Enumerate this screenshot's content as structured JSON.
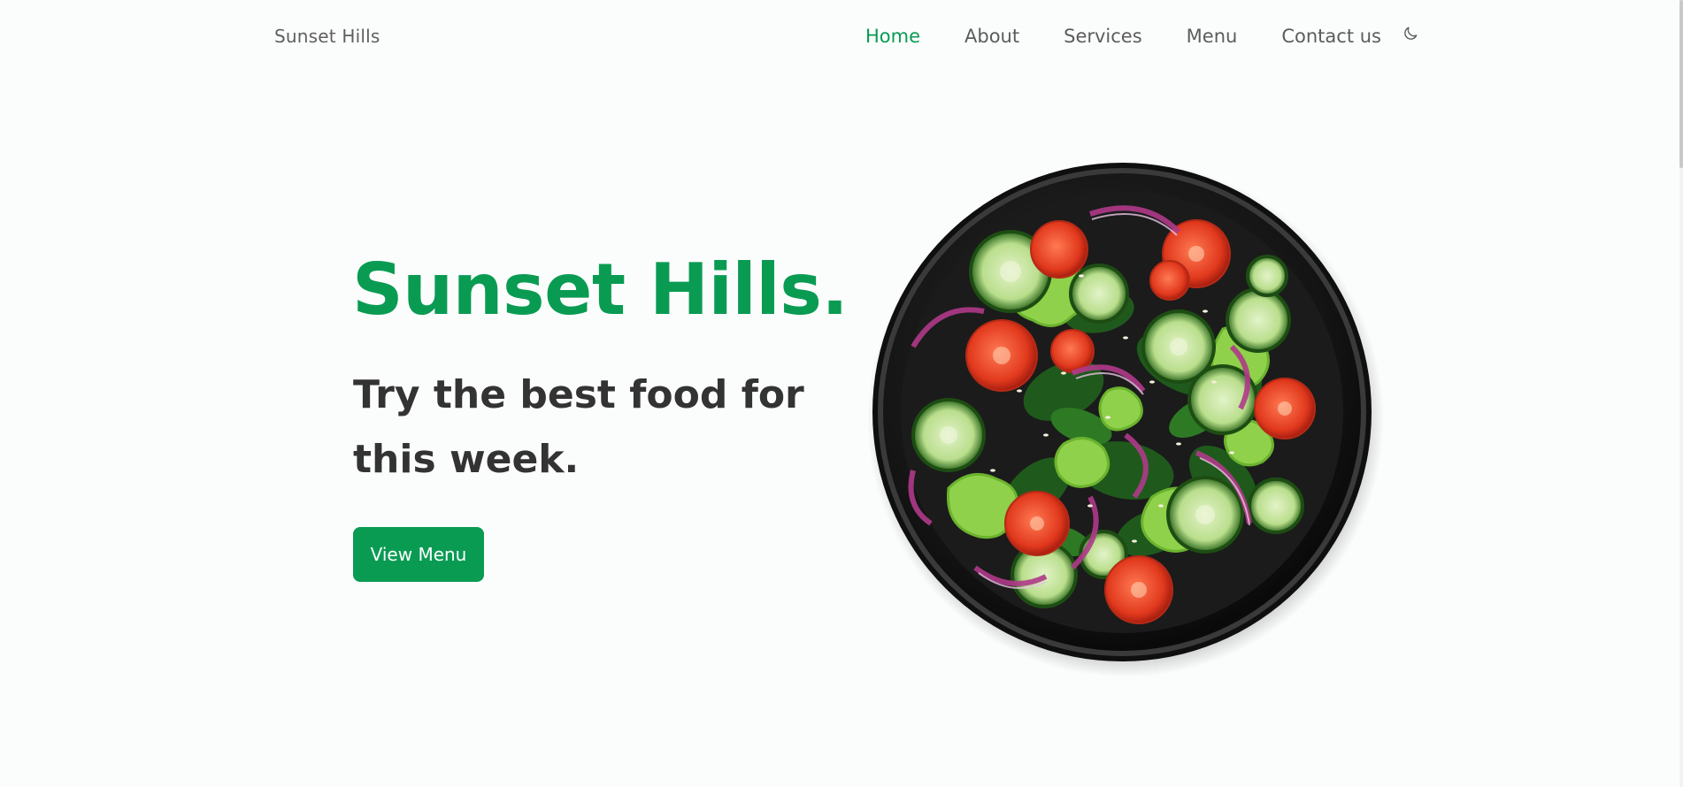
{
  "header": {
    "brand": "Sunset Hills",
    "nav": [
      {
        "label": "Home",
        "active": true
      },
      {
        "label": "About",
        "active": false
      },
      {
        "label": "Services",
        "active": false
      },
      {
        "label": "Menu",
        "active": false
      },
      {
        "label": "Contact us",
        "active": false
      }
    ],
    "theme_toggle_icon": "moon-icon"
  },
  "hero": {
    "title": "Sunset Hills.",
    "subtitle": "Try the best food for this week.",
    "cta_label": "View Menu",
    "image_icon": "salad-bowl-image"
  },
  "colors": {
    "accent": "#0a9b53",
    "text_dark": "#333333",
    "text_muted": "#5c5c5c",
    "background": "#fbfdfc"
  }
}
